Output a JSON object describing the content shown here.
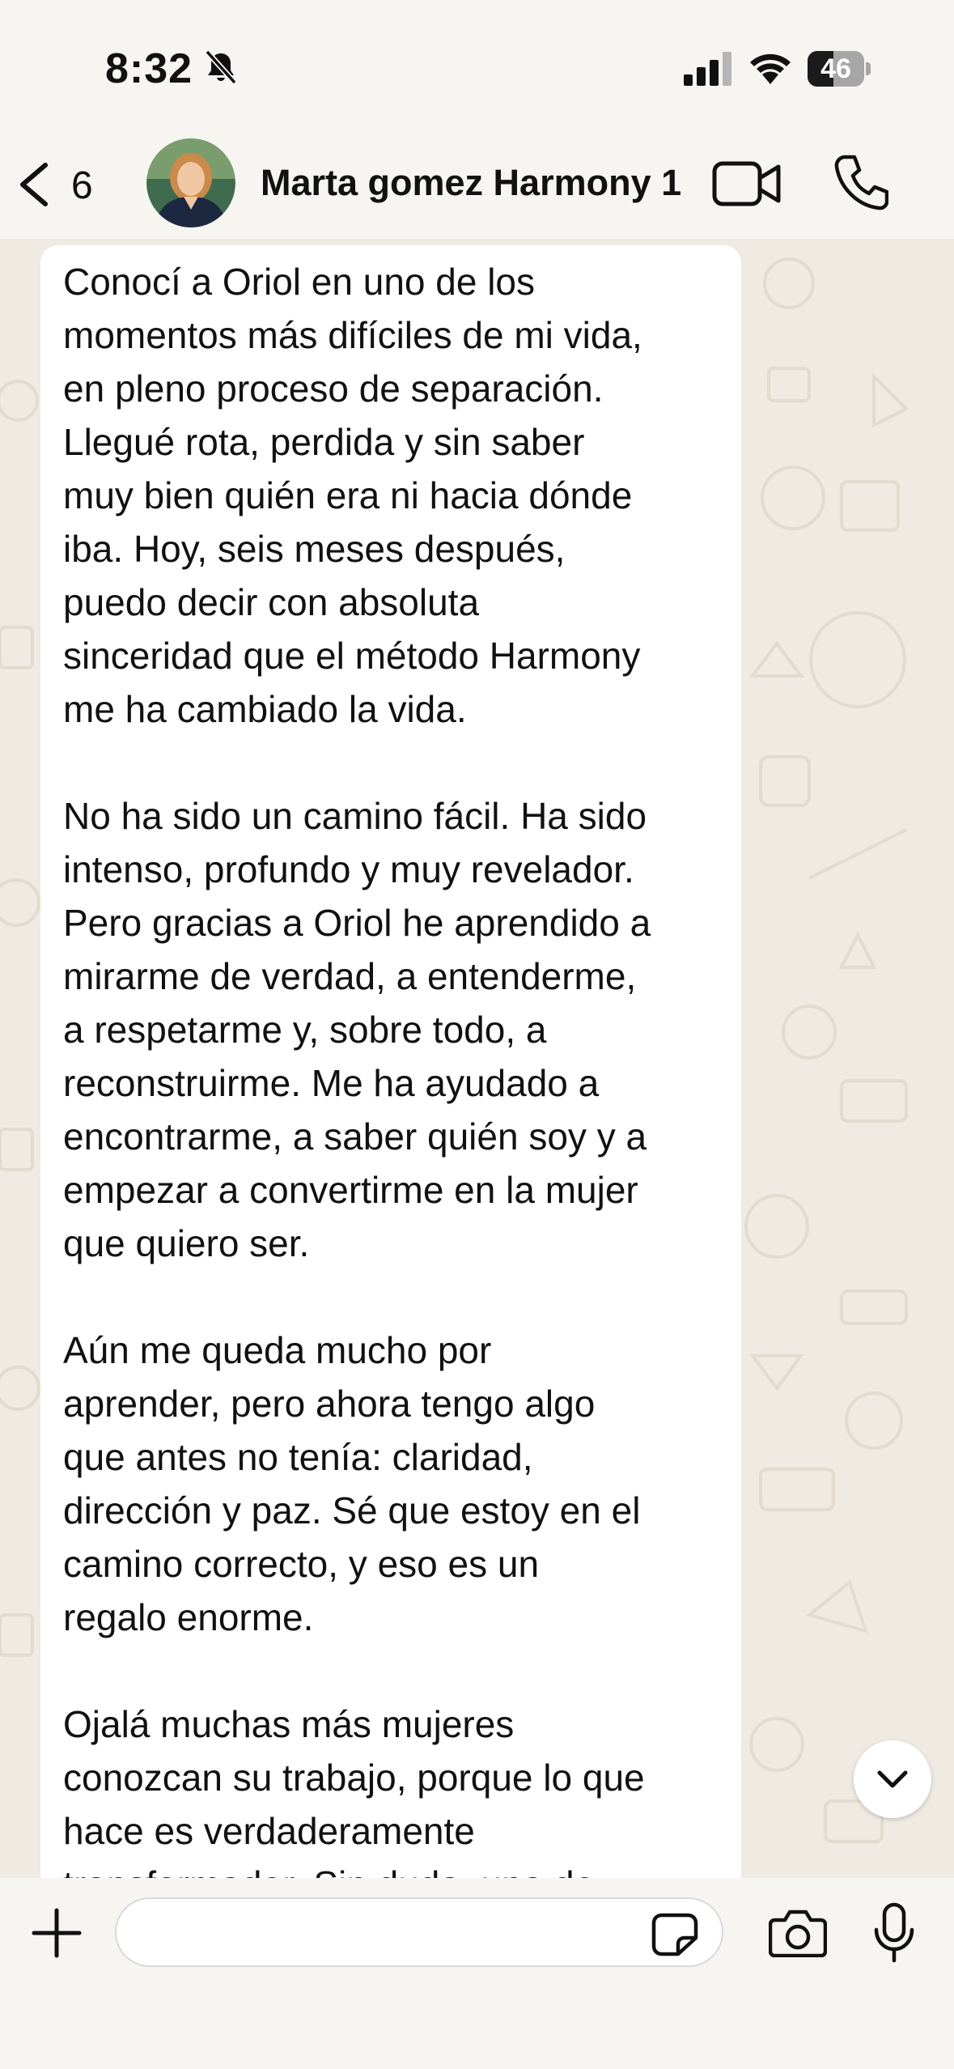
{
  "status_bar": {
    "time": "8:32",
    "battery_level": "46",
    "icons": [
      "bell-slash-icon",
      "cellular-signal-icon",
      "wifi-icon",
      "battery-icon"
    ]
  },
  "header": {
    "back_count": "6",
    "contact_name": "Marta gomez Harmony 1",
    "icons": [
      "chevron-left-icon",
      "avatar",
      "video-call-icon",
      "phone-icon"
    ]
  },
  "chat": {
    "message": "Conocí a Oriol en uno de los\nmomentos más difíciles de mi vida,\nen pleno proceso de separación.\nLlegué rota, perdida y sin saber\nmuy bien quién era ni hacia dónde\niba. Hoy, seis meses después,\npuedo decir con absoluta\nsinceridad que el método Harmony\nme ha cambiado la vida.\n\nNo ha sido un camino fácil. Ha sido\nintenso, profundo y muy revelador.\nPero gracias a Oriol he aprendido a\nmirarme de verdad, a entenderme,\na respetarme y, sobre todo, a\nreconstruirme. Me ha ayudado a\nencontrarme, a saber quién soy y a\nempezar a convertirme en la mujer\nque quiero ser.\n\nAún me queda mucho por\naprender, pero ahora tengo algo\nque antes no tenía: claridad,\ndirección y paz. Sé que estoy en el\ncamino correcto, y eso es un\nregalo enorme.\n\nOjalá muchas más mujeres\nconozcan su trabajo, porque lo que\nhace es verdaderamente\ntransformador. Sin duda, una de\nlas mejores decisiones de mi vida.",
    "scroll_button_icon": "chevron-down-icon"
  },
  "input_bar": {
    "text_value": "",
    "icons": [
      "plus-icon",
      "sticker-icon",
      "camera-icon",
      "microphone-icon"
    ]
  },
  "colors": {
    "chat_background": "#efeae2",
    "bubble": "#ffffff",
    "bars": "#f6f5f2",
    "text": "#111111"
  }
}
